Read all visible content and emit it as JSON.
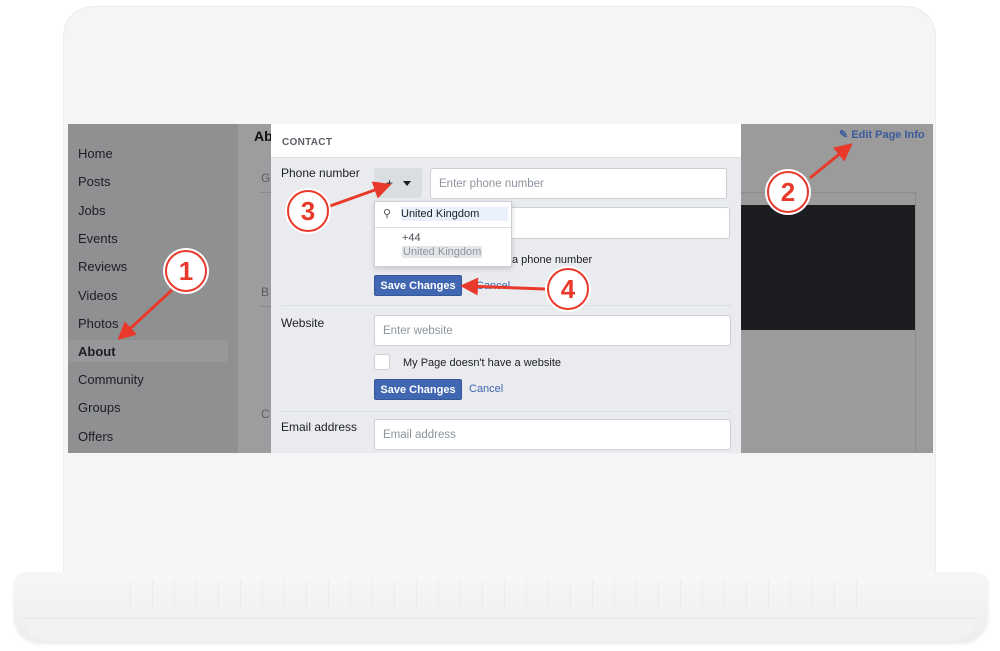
{
  "sidebar": {
    "items": [
      {
        "label": "Home"
      },
      {
        "label": "Posts"
      },
      {
        "label": "Jobs"
      },
      {
        "label": "Events"
      },
      {
        "label": "Reviews"
      },
      {
        "label": "Videos"
      },
      {
        "label": "Photos"
      },
      {
        "label": "About",
        "active": true
      },
      {
        "label": "Community"
      },
      {
        "label": "Groups"
      },
      {
        "label": "Offers"
      }
    ]
  },
  "about_column": {
    "heading_partial": "Ab",
    "letters": [
      "G",
      "B",
      "C"
    ]
  },
  "header": {
    "edit_page_info": "Edit Page Info"
  },
  "modal": {
    "section_title": "CONTACT",
    "phone": {
      "label": "Phone number",
      "country_code_partial": "+",
      "input_placeholder": "Enter phone number",
      "no_phone_text_partial": "a phone number",
      "save_label": "Save Changes",
      "cancel_label": "Cancel",
      "dropdown": {
        "search_value": "United Kingdom",
        "options": [
          {
            "dial_code": "+44",
            "country": "United Kingdom"
          }
        ]
      }
    },
    "website": {
      "label": "Website",
      "input_placeholder": "Enter website",
      "checkbox_label": "My Page doesn't have a website",
      "checkbox_checked": false,
      "save_label": "Save Changes",
      "cancel_label": "Cancel"
    },
    "email": {
      "label": "Email address",
      "input_placeholder": "Email address"
    }
  },
  "annotations": [
    {
      "number": "1",
      "target": "About"
    },
    {
      "number": "2",
      "target": "Edit Page Info"
    },
    {
      "number": "3",
      "target": "Country code selector"
    },
    {
      "number": "4",
      "target": "Save Changes"
    }
  ],
  "colors": {
    "accent": "#4267b2",
    "annotation": "#e8392a",
    "link": "#3b5a9b"
  }
}
